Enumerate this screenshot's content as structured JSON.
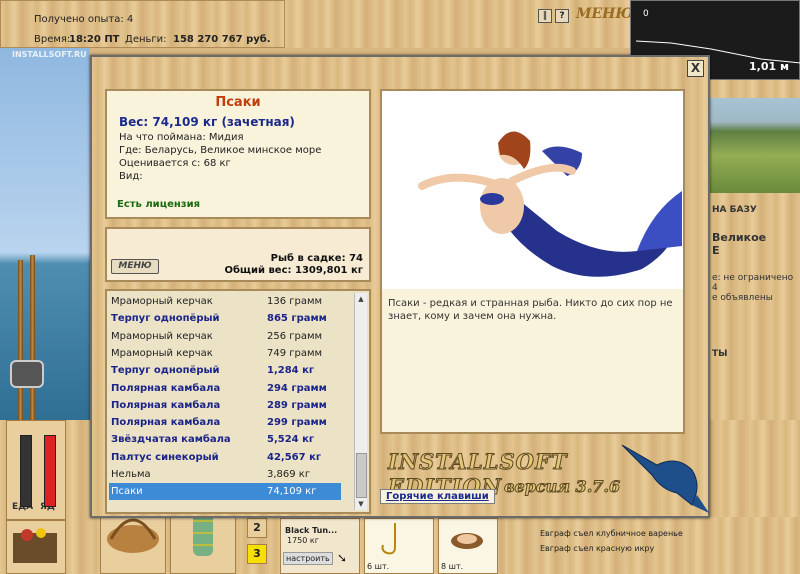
{
  "status": {
    "experience": "Получено опыта: 4",
    "time_label": "Время:",
    "time_value": "18:20 ПТ",
    "money_label": "Деньги:",
    "money_value": "158 270 767 руб."
  },
  "watermark": "INSTALLSOFT.RU",
  "top_menu": {
    "menu_label": "МЕНЮ",
    "pause_icon": "pause-icon",
    "help_label": "?"
  },
  "depth": {
    "zero_label": "0",
    "value": "1,01 м"
  },
  "background_right": {
    "to_base": "НА БАЗУ",
    "lake": "Великое",
    "lake2": "Е",
    "limit": "е: не ограничено",
    "num": "4",
    "ads": "е объявлены",
    "sell": "ТЫ"
  },
  "bottom": {
    "food_label": "ЕДА",
    "eat_label": "ЯД",
    "slot2": "2",
    "slot3": "3",
    "bait_name": "Black Tun...",
    "bait_weight": "1750 кг",
    "setup_button": "настроить",
    "hook_count": "6 шт.",
    "shell_count": "8 шт.",
    "events": [
      "Евграф съел клубничное варенье",
      "Евграф съел красную икру"
    ]
  },
  "popup": {
    "close": "X",
    "fish": {
      "name": "Псаки",
      "weight": "Вес: 74,109 кг (зачетная)",
      "caught_on": "На что поймана: Мидия",
      "where": "Где: Беларусь, Великое минское море",
      "rated_from": "Оценивается с: 68 кг",
      "kind": "Вид:",
      "license": "Есть лицензия"
    },
    "stats": {
      "menu_button": "МЕНЮ",
      "cage_count": "Рыб в садке: 74",
      "total_weight": "Общий вес: 1309,801 кг"
    },
    "catch_list": [
      {
        "name": "Мраморный керчак",
        "weight": "136 грамм",
        "bold": false
      },
      {
        "name": "Терпуг однопёрый",
        "weight": "865 грамм",
        "bold": true
      },
      {
        "name": "Мраморный керчак",
        "weight": "256 грамм",
        "bold": false
      },
      {
        "name": "Мраморный керчак",
        "weight": "749 грамм",
        "bold": false
      },
      {
        "name": "Терпуг однопёрый",
        "weight": "1,284 кг",
        "bold": true
      },
      {
        "name": "Полярная камбала",
        "weight": "294 грамм",
        "bold": true
      },
      {
        "name": "Полярная камбала",
        "weight": "289 грамм",
        "bold": true
      },
      {
        "name": "Полярная камбала",
        "weight": "299 грамм",
        "bold": true
      },
      {
        "name": "Звёздчатая камбала",
        "weight": "5,524 кг",
        "bold": true
      },
      {
        "name": "Палтус синекорый",
        "weight": "42,567 кг",
        "bold": true
      },
      {
        "name": "Нельма",
        "weight": "3,869 кг",
        "bold": false
      },
      {
        "name": "Псаки",
        "weight": "74,109 кг",
        "bold": false,
        "selected": true
      }
    ],
    "description": "Псаки - редкая и странная рыба. Никто до сих пор не знает, кому и зачем она нужна.",
    "brand": "INSTALLSOFT EDITION",
    "version": "версия 3.7.6",
    "hotkeys": "Горячие клавиши"
  }
}
